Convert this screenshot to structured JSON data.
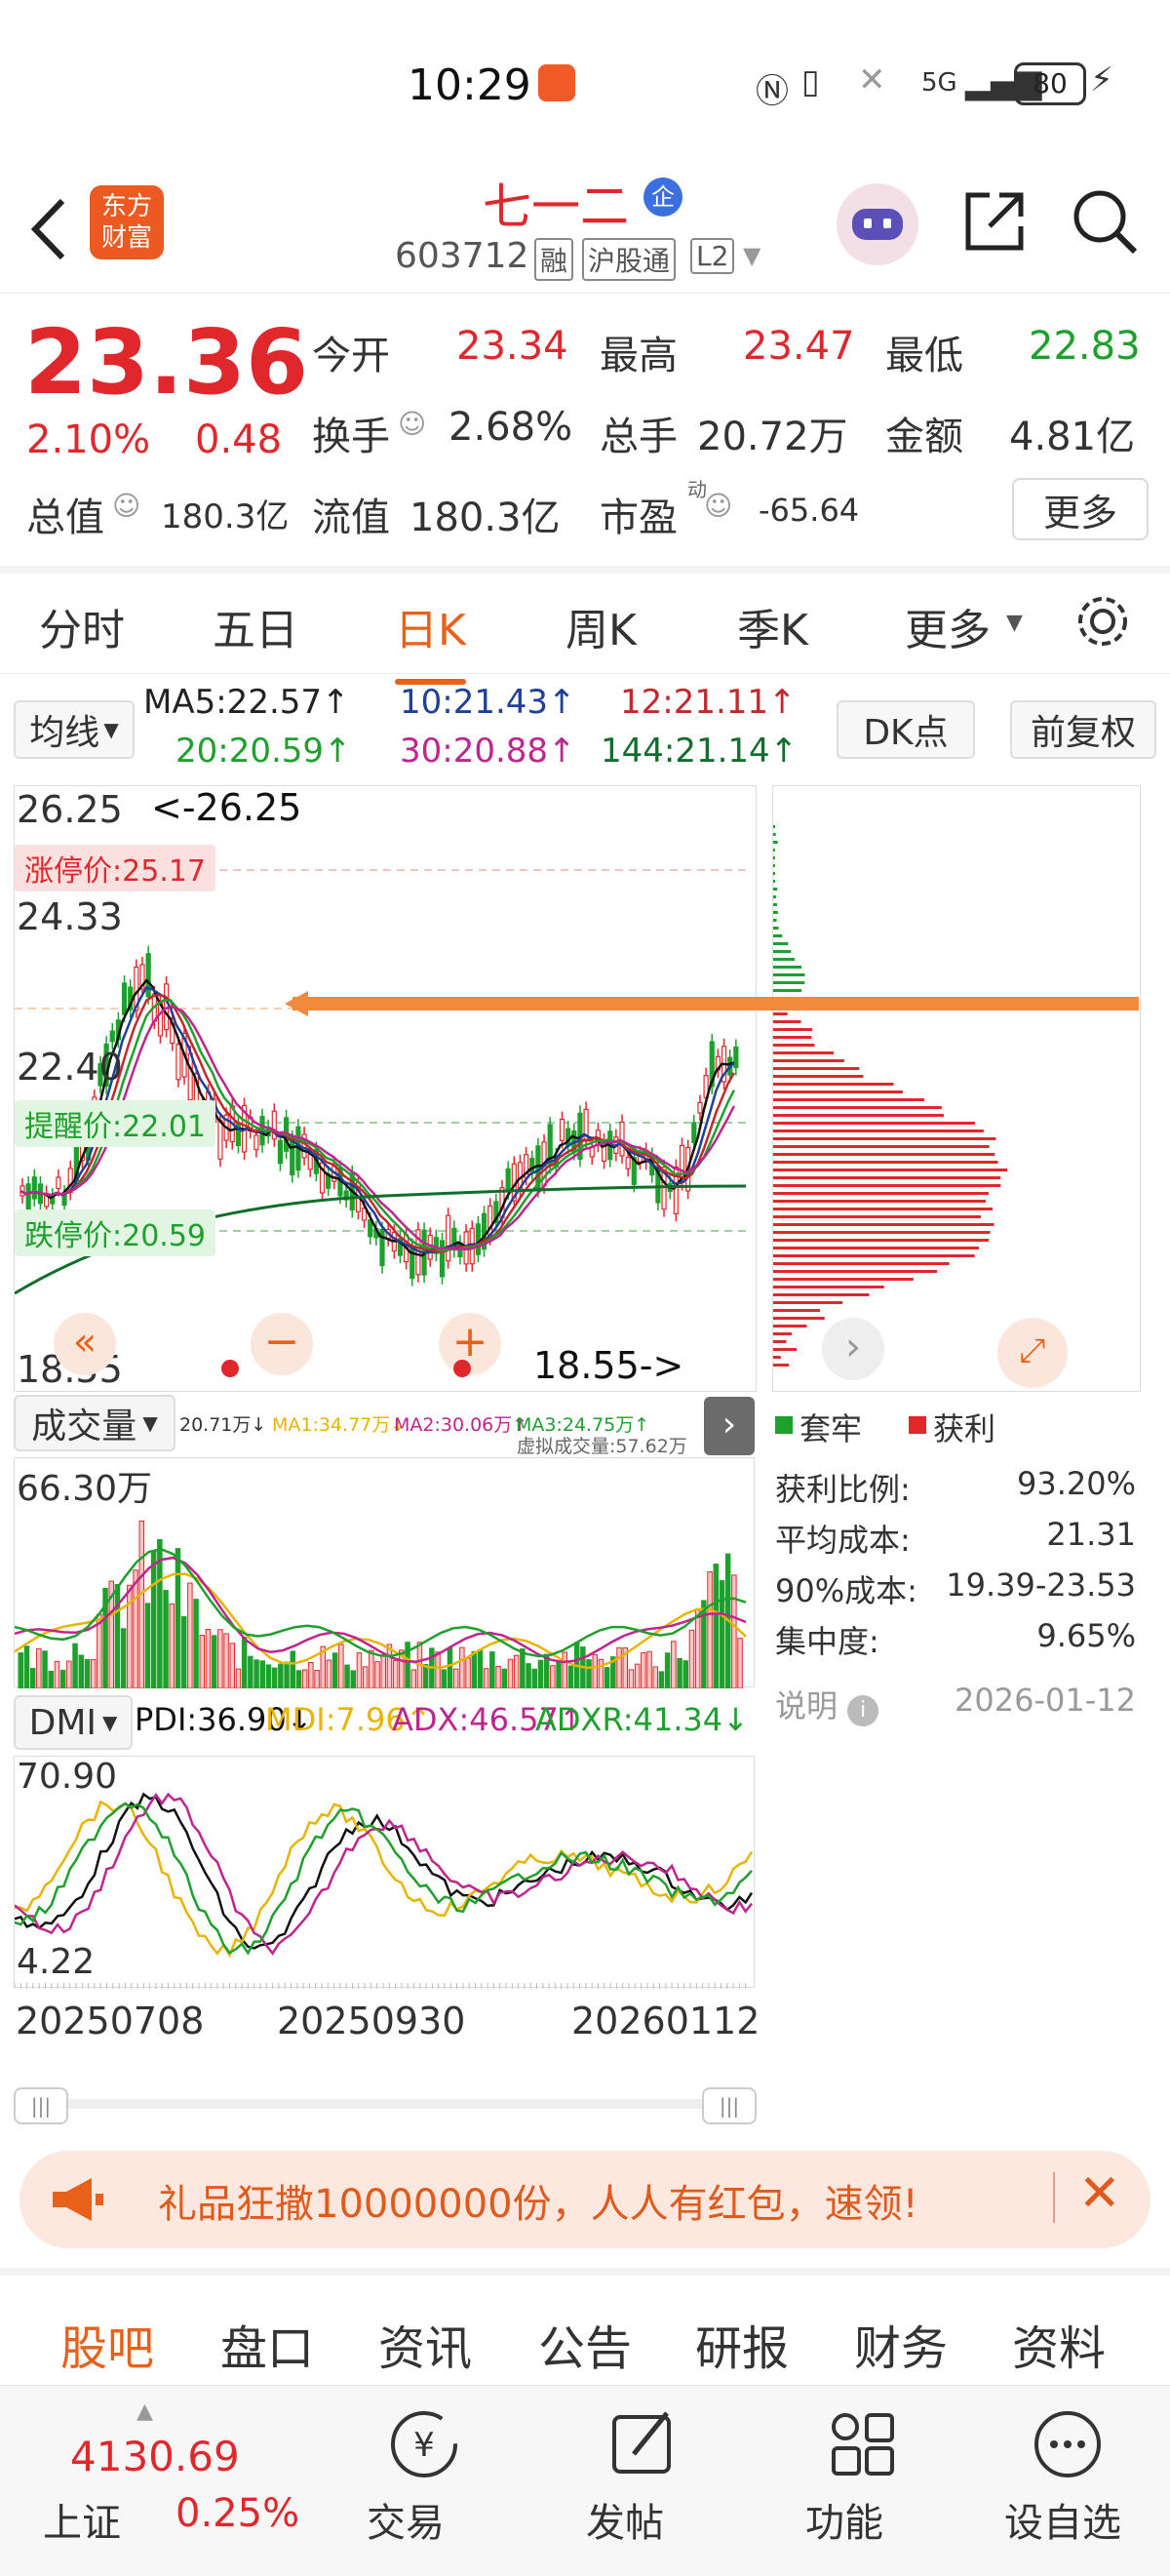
{
  "status_bar": {
    "time": "10:29",
    "network": "5G",
    "battery": "80"
  },
  "header": {
    "brand_line1": "东方",
    "brand_line2": "财富",
    "stock_name": "七一二",
    "badge": "企",
    "code": "603712",
    "tag_margin": "融",
    "tag_connect": "沪股通",
    "tag_level": "L2"
  },
  "quote": {
    "price": "23.36",
    "change_pct": "2.10%",
    "change": "0.48",
    "open_label": "今开",
    "open": "23.34",
    "high_label": "最高",
    "high": "23.47",
    "low_label": "最低",
    "low": "22.83",
    "turnover_label": "换手",
    "turnover": "2.68%",
    "volume_label": "总手",
    "volume": "20.72万",
    "amount_label": "金额",
    "amount": "4.81亿",
    "mktcap_label": "总值",
    "mktcap": "180.3亿",
    "float_label": "流值",
    "float_cap": "180.3亿",
    "pe_label": "市盈",
    "pe_sup": "动",
    "pe": "-65.64",
    "more_button": "更多"
  },
  "period_tabs": [
    {
      "label": "分时"
    },
    {
      "label": "五日"
    },
    {
      "label": "日K"
    },
    {
      "label": "周K"
    },
    {
      "label": "季K"
    },
    {
      "label": "更多"
    }
  ],
  "active_tab": 2,
  "ma_bar": {
    "selector": "均线",
    "ma5": "MA5:22.57↑",
    "ma10": "10:21.43↑",
    "ma12": "12:21.11↑",
    "ma20": "20:20.59↑",
    "ma30": "30:20.88↑",
    "ma144": "144:21.14↑",
    "dk_button": "DK点",
    "adjust_button": "前复权"
  },
  "price_chart": {
    "max_label": "26.25",
    "max_marker": "<-26.25",
    "limit_up_label": "涨停价:25.17",
    "level_24": "24.33",
    "level_22": "22.40",
    "alert_label": "提醒价:22.01",
    "limit_down_label": "跌停价:20.59",
    "min_label": "18.55",
    "min_marker": "18.55->"
  },
  "chip_panel": {
    "legend_trapped": "套牢",
    "legend_profit": "获利",
    "rows": [
      {
        "label": "获利比例:",
        "value": "93.20%"
      },
      {
        "label": "平均成本:",
        "value": "21.31"
      },
      {
        "label": "90%成本:",
        "value": "19.39-23.53"
      },
      {
        "label": "集中度:",
        "value": "9.65%"
      }
    ],
    "note_label": "说明",
    "date": "2026-01-12"
  },
  "volume_panel": {
    "selector": "成交量",
    "header": "20.71万↓",
    "ma1": "MA1:34.77万↓",
    "ma2": "MA2:30.06万↑",
    "ma3": "MA3:24.75万↑",
    "virtual": "虚拟成交量:57.62万",
    "max_label": "66.30万"
  },
  "dmi_panel": {
    "selector": "DMI",
    "pdi": "PDI:36.90↓",
    "mdi": "MDI:7.96↑",
    "adx": "ADX:46.57↑",
    "adxr": "ADXR:41.34↓",
    "max_label": "70.90",
    "min_label": "4.22"
  },
  "x_axis": [
    "20250708",
    "20250930",
    "20260112"
  ],
  "banner": {
    "text": "礼品狂撒10000000份，人人有红包，速领!"
  },
  "bottom_tabs": [
    {
      "label": "股吧"
    },
    {
      "label": "盘口"
    },
    {
      "label": "资讯"
    },
    {
      "label": "公告"
    },
    {
      "label": "研报"
    },
    {
      "label": "财务"
    },
    {
      "label": "资料"
    }
  ],
  "footer": {
    "index_value": "4130.69",
    "index_name": "上证",
    "index_change": "0.25%",
    "trade": "交易",
    "post": "发帖",
    "function": "功能",
    "watchlist": "设自选"
  },
  "colors": {
    "up": "#e0282c",
    "down": "#1ea02d",
    "accent": "#e8611a"
  }
}
